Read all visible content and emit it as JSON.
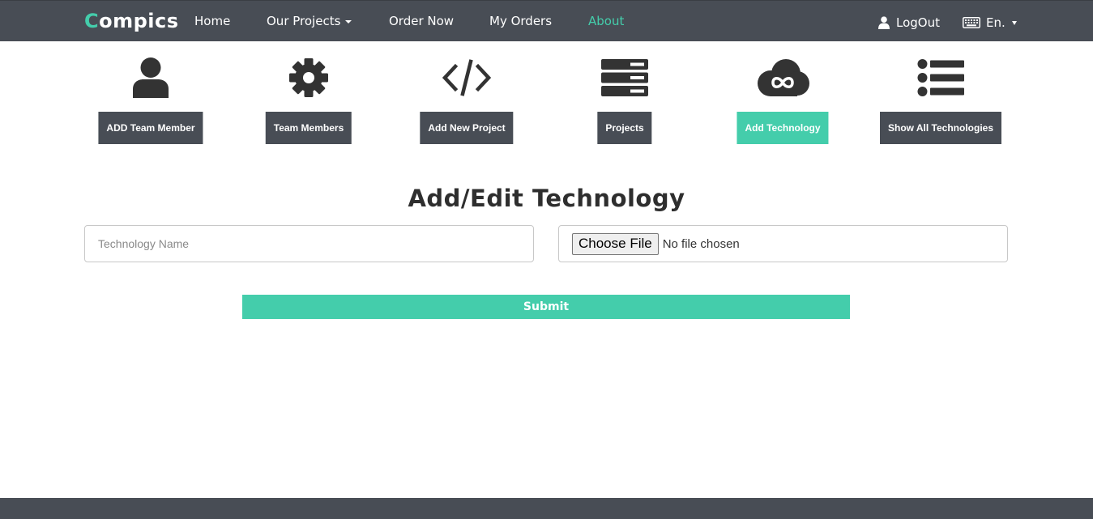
{
  "colors": {
    "nav_bg": "#484d55",
    "accent": "#44cdab",
    "white": "#ffffff"
  },
  "brand": {
    "first_letter": "C",
    "rest": "ompics"
  },
  "nav": {
    "home": "Home",
    "our_projects": "Our Projects",
    "order_now": "Order Now",
    "my_orders": "My Orders",
    "about": "About",
    "logout": "LogOut",
    "language": "En."
  },
  "tiles": [
    {
      "label": "ADD Team Member",
      "icon": "user-icon"
    },
    {
      "label": "Team Members",
      "icon": "gear-icon"
    },
    {
      "label": "Add New Project",
      "icon": "code-icon"
    },
    {
      "label": "Projects",
      "icon": "server-icon"
    },
    {
      "label": "Add Technology",
      "icon": "cloud-infinity-icon",
      "active": true
    },
    {
      "label": "Show All Technologies",
      "icon": "list-icon"
    }
  ],
  "form": {
    "title": "Add/Edit Technology",
    "name_placeholder": "Technology Name",
    "name_value": "",
    "file_button": "Choose File",
    "file_status": "No file chosen",
    "submit": "Submit"
  }
}
